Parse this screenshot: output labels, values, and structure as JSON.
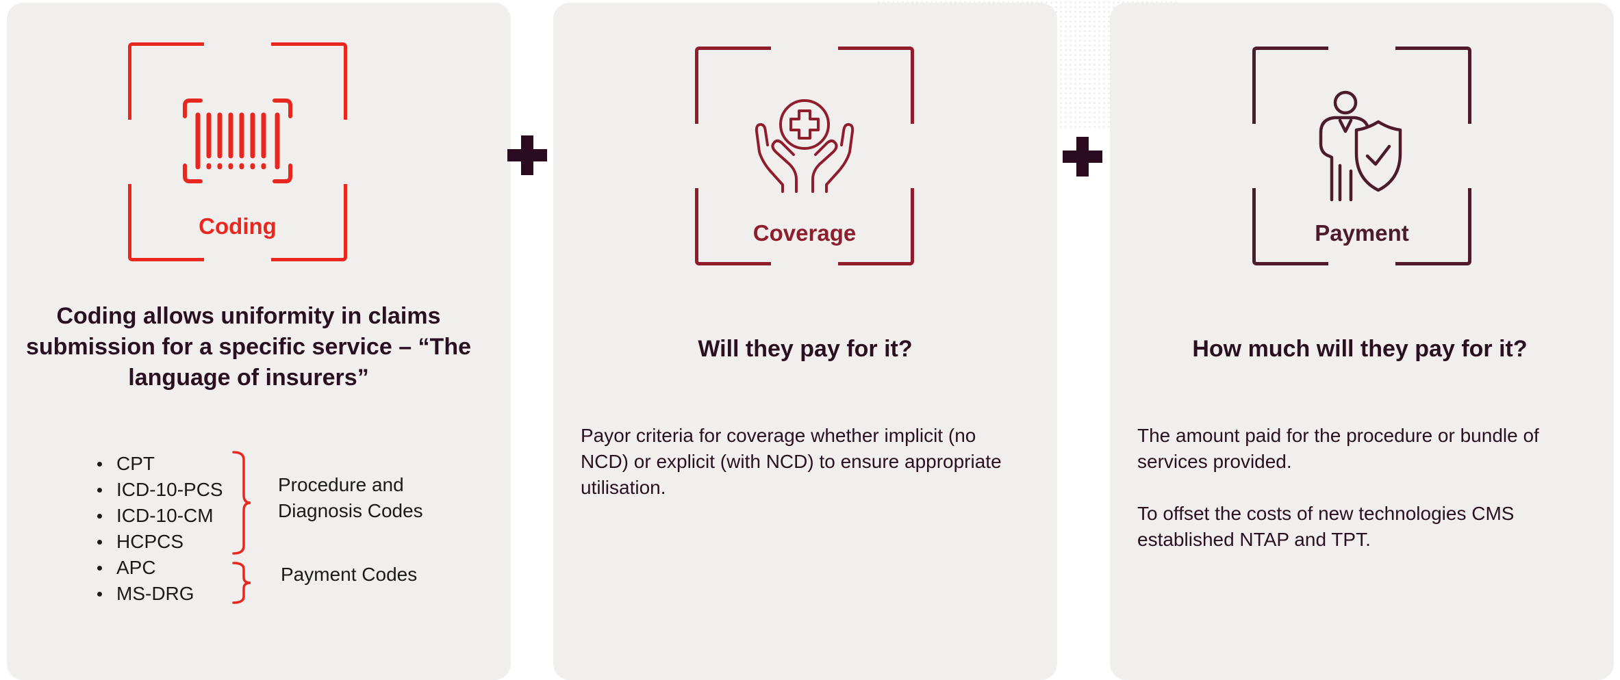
{
  "plus_symbol_color": "#2b0b1f",
  "panels": {
    "coding": {
      "label": "Coding",
      "color": "#e8281e",
      "icon": "barcode-icon",
      "heading_lines": [
        "Coding allows uniformity in claims",
        "submission for a specific service –  “The",
        "language of insurers”"
      ],
      "codes": [
        "CPT",
        "ICD-10-PCS",
        "ICD-10-CM",
        "HCPCS",
        "APC",
        "MS-DRG"
      ],
      "procedure_group_label_lines": [
        "Procedure and",
        "Diagnosis Codes"
      ],
      "payment_group_label": "Payment Codes"
    },
    "coverage": {
      "label": "Coverage",
      "color": "#8f1d2c",
      "icon": "hands-medical-cross-icon",
      "heading": "Will they pay for it?",
      "body_lines": [
        "Payor criteria for coverage whether implicit (no",
        "NCD) or explicit (with NCD) to ensure appropriate",
        "utilisation."
      ]
    },
    "payment": {
      "label": "Payment",
      "color": "#4e1a2e",
      "icon": "person-shield-check-icon",
      "heading": "How much will they pay for it?",
      "paragraph1_lines": [
        "The amount paid for the procedure or bundle of",
        "services provided."
      ],
      "paragraph2_lines": [
        "To offset the costs of new technologies CMS",
        "established NTAP and TPT."
      ]
    }
  }
}
